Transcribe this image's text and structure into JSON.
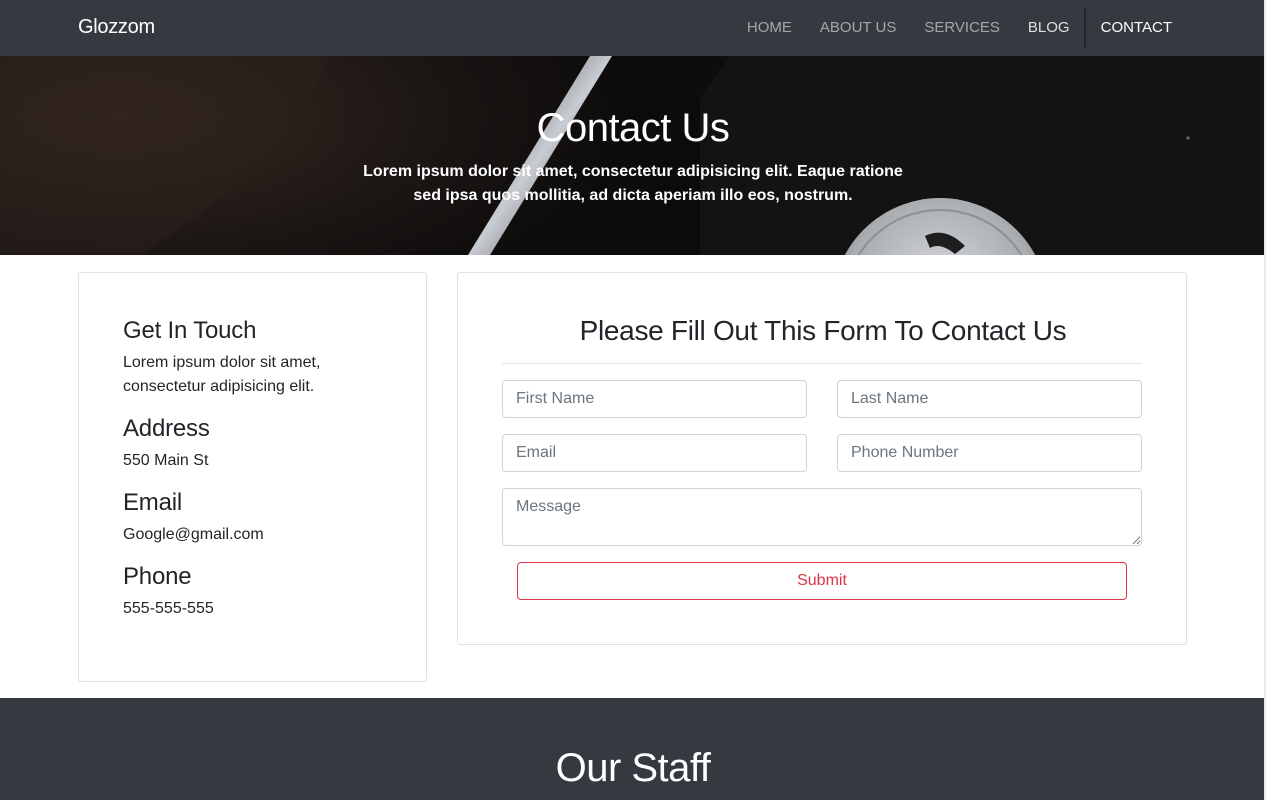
{
  "navbar": {
    "brand": "Glozzom",
    "items": [
      {
        "label": "HOME"
      },
      {
        "label": "ABOUT US"
      },
      {
        "label": "SERVICES"
      },
      {
        "label": "BLOG"
      },
      {
        "label": "CONTACT",
        "active": true
      }
    ]
  },
  "hero": {
    "title": "Contact Us",
    "subtitle": "Lorem ipsum dolor sit amet, consectetur adipisicing elit. Eaque ratione sed ipsa quos mollitia, ad dicta aperiam illo eos, nostrum."
  },
  "info": {
    "touch_heading": "Get In Touch",
    "touch_text": "Lorem ipsum dolor sit amet, consectetur adipisicing elit.",
    "address_heading": "Address",
    "address_value": "550 Main St",
    "email_heading": "Email",
    "email_value": "Google@gmail.com",
    "phone_heading": "Phone",
    "phone_value": "555-555-555"
  },
  "form": {
    "title": "Please Fill Out This Form To Contact Us",
    "first_name_placeholder": "First Name",
    "last_name_placeholder": "Last Name",
    "email_placeholder": "Email",
    "phone_placeholder": "Phone Number",
    "message_placeholder": "Message",
    "submit_label": "Submit"
  },
  "staff": {
    "title": "Our Staff"
  },
  "colors": {
    "navbar_bg": "#343a40",
    "submit_accent": "#dc3545",
    "staff_bg": "#343a40"
  }
}
